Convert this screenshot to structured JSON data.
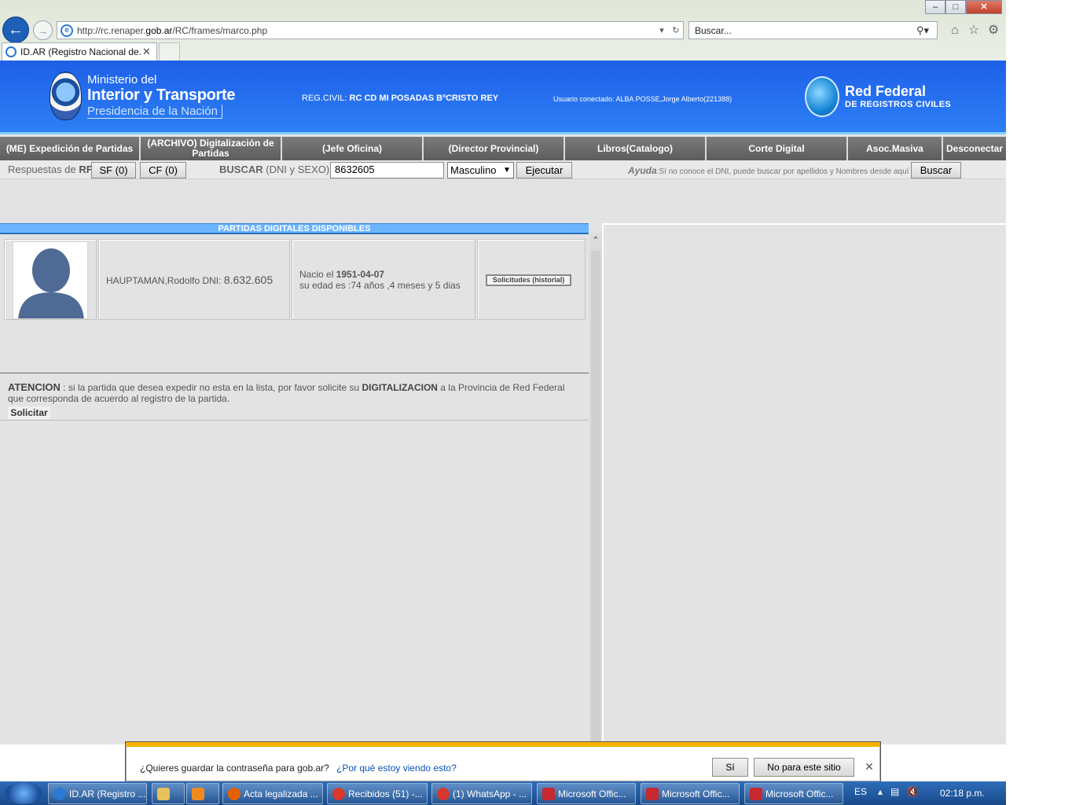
{
  "browser": {
    "url_prefix": "http://rc.renaper.",
    "url_domain": "gob.ar",
    "url_suffix": "/RC/frames/marco.php",
    "search_placeholder": "Buscar...",
    "tab_title": "ID.AR (Registro Nacional de...",
    "icons": [
      "back-arrow-icon",
      "forward-arrow-icon",
      "refresh-icon",
      "search-icon",
      "home-icon",
      "star-icon",
      "gear-icon"
    ]
  },
  "banner": {
    "ministry_line1": "Ministerio del",
    "ministry_line2": "Interior y Transporte",
    "ministry_line3": "Presidencia de la Nación",
    "regcivil_label": "REG.CIVIL:",
    "regcivil_value": "RC CD MI POSADAS BºCRISTO REY",
    "usuario": "Usuario conectado: ALBA POSSE,Jorge Alberto(221388)",
    "rf_line1": "Red Federal",
    "rf_line2": "DE REGISTROS CIVILES"
  },
  "menu": {
    "items": [
      "(ME) Expedición de Partidas",
      "(ARCHIVO) Digitalización de Partidas",
      "(Jefe Oficina)",
      "(Director Provincial)",
      "Libros(Catalogo)",
      "Corte Digital",
      "Asoc.Masiva",
      "Desconectar"
    ]
  },
  "toolbar": {
    "respuestas_label": "Respuestas de",
    "respuestas_rf": "RF",
    "sf_button": "SF (0)",
    "cf_button": "CF (0)",
    "buscar_label": "BUSCAR",
    "buscar_hint": "(DNI y SEXO)",
    "dni_value": "8632605",
    "sexo_value": "Masculino",
    "ejecutar_button": "Ejecutar",
    "ayuda_label": "Ayuda",
    "ayuda_text": ":Sí no conoce el DNI, puede buscar por apellidos y Nombres desde aquí",
    "buscar_button": "Buscar"
  },
  "results": {
    "header": "PARTIDAS DIGITALES DISPONIBLES",
    "person_name": "HAUPTAMAN,Rodolfo DNI:",
    "person_dni": "8.632.605",
    "nacio_label": "Nacio el",
    "nacio_date": "1951-04-07",
    "edad_text": "su edad es :74 años ,4 meses y 5 dias",
    "history_button": "Solicitudes (historial)"
  },
  "attention": {
    "lead": "ATENCION",
    "text1": ": si la partida que desea expedir no esta en la lista, por favor solicite su",
    "keyword": "DIGITALIZACION",
    "text2": "a la Provincia de Red Federal que corresponda de acuerdo al registro de la partida.",
    "solicitar_button": "Solicitar"
  },
  "notification": {
    "question": "¿Quieres guardar la contraseña para gob.ar?",
    "why_link": "¿Por qué estoy viendo esto?",
    "yes_button": "Sí",
    "no_button": "No para este sitio"
  },
  "taskbar": {
    "tasks": [
      "ID.AR (Registro ...",
      "",
      "",
      "Acta legalizada ...",
      "Recibidos (51) -...",
      "(1) WhatsApp - ...",
      "Microsoft Offic...",
      "Microsoft Offic...",
      "Microsoft Offic..."
    ],
    "language": "ES",
    "clock": "02:18 p.m."
  }
}
